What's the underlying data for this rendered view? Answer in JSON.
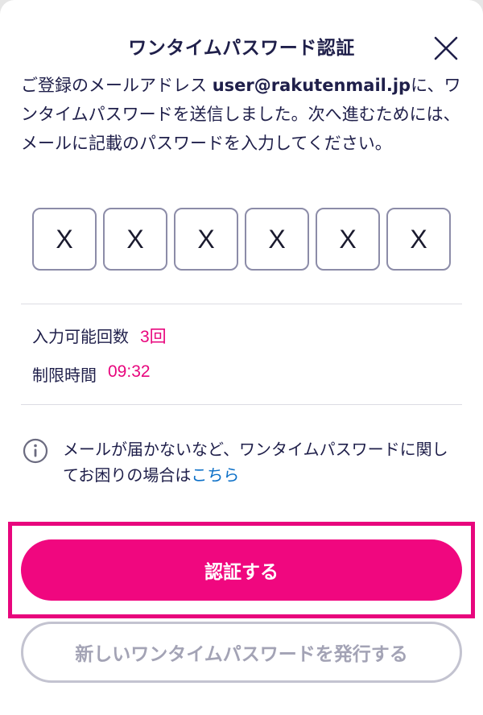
{
  "dialog": {
    "title": "ワンタイムパスワード認証",
    "close_icon": "close-icon"
  },
  "description": {
    "prefix": "ご登録のメールアドレス ",
    "email": "user@rakutenmail.jp",
    "suffix": "に、ワンタイムパスワードを送信しました。次へ進むためには、メールに記載のパスワードを入力してください。"
  },
  "code_inputs": [
    "X",
    "X",
    "X",
    "X",
    "X",
    "X"
  ],
  "attempts": {
    "label": "入力可能回数",
    "value": "3回"
  },
  "time_limit": {
    "label": "制限時間",
    "value": "09:32"
  },
  "help": {
    "icon": "info-icon",
    "text": "メールが届かないなど、ワンタイムパスワードに関してお困りの場合は",
    "link_label": "こちら"
  },
  "buttons": {
    "submit_label": "認証する",
    "resend_label": "新しいワンタイムパスワードを発行する"
  },
  "colors": {
    "accent": "#f0077f",
    "text": "#1f1f4a",
    "link": "#0b6fc7",
    "highlight": "#e8067d"
  }
}
